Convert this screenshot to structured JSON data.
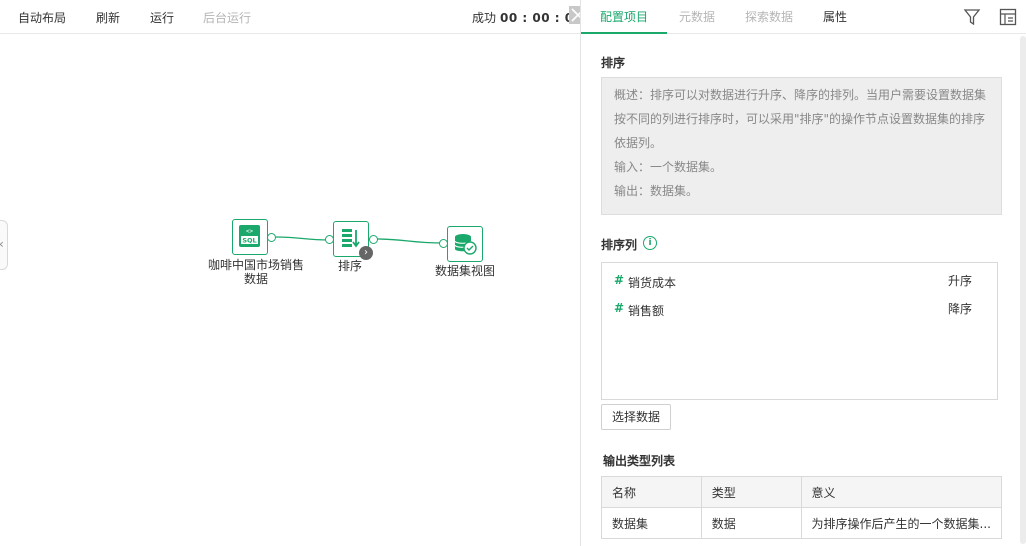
{
  "toolbar": {
    "auto_layout": "自动布局",
    "refresh": "刷新",
    "run": "运行",
    "background_run": "后台运行",
    "status_label": "成功",
    "status_time": "00 : 00 : 01"
  },
  "canvas": {
    "nodes": [
      {
        "label_line1": "咖啡中国市场销售",
        "label_line2": "数据",
        "icon": "sql-icon"
      },
      {
        "label_line1": "排序",
        "icon": "sort-icon"
      },
      {
        "label_line1": "数据集视图",
        "icon": "dataset-view-icon"
      }
    ],
    "badge": "›"
  },
  "tabs": [
    {
      "label": "配置项目",
      "active": true
    },
    {
      "label": "元数据",
      "active": false
    },
    {
      "label": "探索数据",
      "active": false
    },
    {
      "label": "属性",
      "active": false
    }
  ],
  "panel": {
    "sort_title": "排序",
    "description_lines": [
      "概述：排序可以对数据进行升序、降序的排列。当用户需要设置数据集",
      "按不同的列进行排序时，可以采用\"排序\"的操作节点设置数据集的排序",
      "依据列。",
      "输入：一个数据集。",
      "输出：数据集。"
    ],
    "sort_columns_title": "排序列",
    "sort_columns": [
      {
        "name": "销货成本",
        "order": "升序"
      },
      {
        "name": "销售额",
        "order": "降序"
      }
    ],
    "select_data_button": "选择数据",
    "output_title": "输出类型列表",
    "output_table": {
      "headers": [
        "名称",
        "类型",
        "意义"
      ],
      "rows": [
        [
          "数据集",
          "数据",
          "为排序操作后产生的一个数据集..."
        ]
      ]
    }
  },
  "colors": {
    "accent": "#1aa86b",
    "muted": "#b5b5b5"
  }
}
